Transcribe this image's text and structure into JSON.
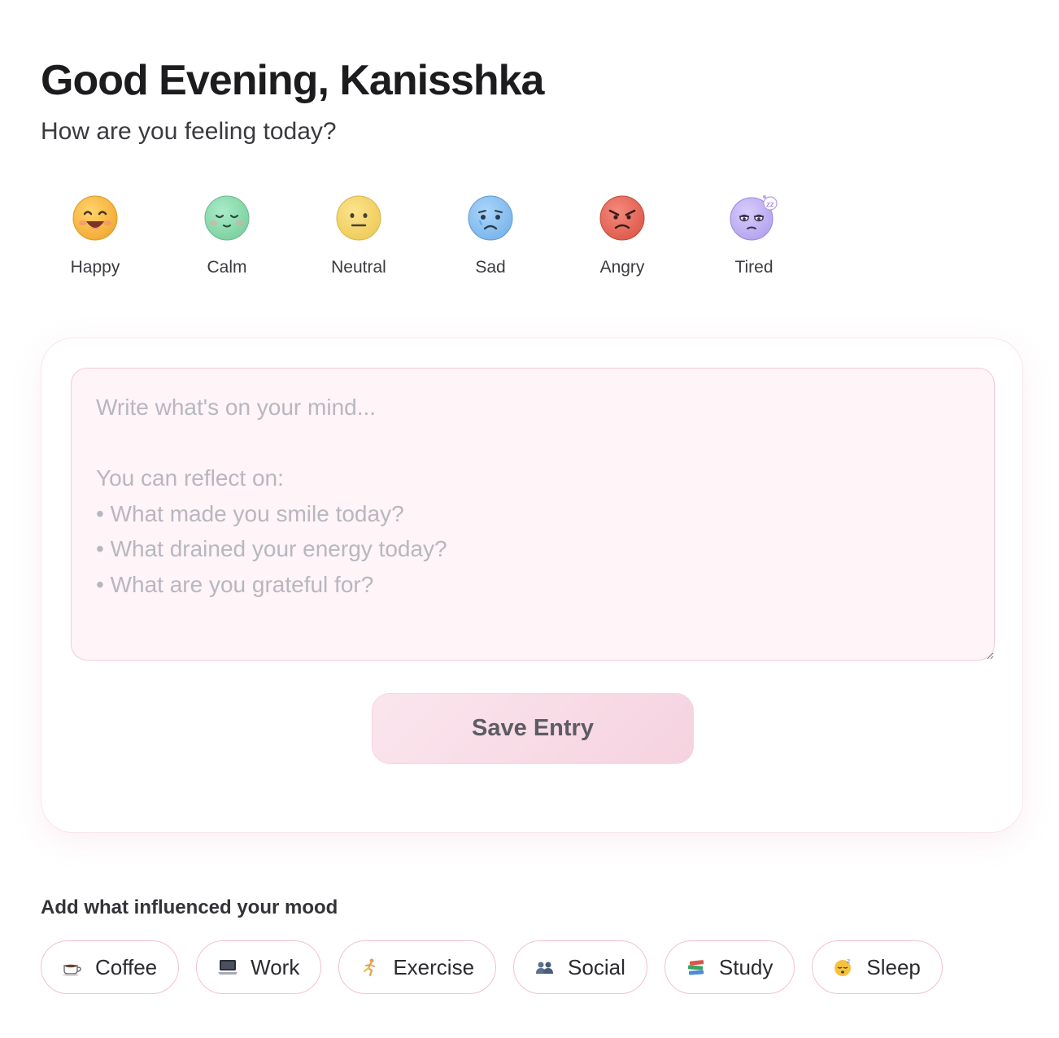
{
  "header": {
    "greeting": "Good Evening, Kanisshka",
    "question": "How are you feeling today?"
  },
  "moods": [
    {
      "label": "Happy",
      "icon": "happy-face-icon",
      "color": "#f5b53f"
    },
    {
      "label": "Calm",
      "icon": "calm-face-icon",
      "color": "#8fd9b0"
    },
    {
      "label": "Neutral",
      "icon": "neutral-face-icon",
      "color": "#f4d46a"
    },
    {
      "label": "Sad",
      "icon": "sad-face-icon",
      "color": "#8ec3f0"
    },
    {
      "label": "Angry",
      "icon": "angry-face-icon",
      "color": "#e86a5c"
    },
    {
      "label": "Tired",
      "icon": "tired-face-icon",
      "color": "#c5b6f2"
    }
  ],
  "journal": {
    "placeholder": "Write what's on your mind...\n\nYou can reflect on:\n• What made you smile today?\n• What drained your energy today?\n• What are you grateful for?",
    "value": "",
    "save_label": "Save Entry"
  },
  "influences": {
    "title": "Add what influenced your mood",
    "chips": [
      {
        "label": "Coffee",
        "icon": "coffee-icon"
      },
      {
        "label": "Work",
        "icon": "laptop-icon"
      },
      {
        "label": "Exercise",
        "icon": "running-icon"
      },
      {
        "label": "Social",
        "icon": "people-icon"
      },
      {
        "label": "Study",
        "icon": "books-icon"
      },
      {
        "label": "Sleep",
        "icon": "sleeping-face-icon"
      }
    ]
  },
  "colors": {
    "accent_pink": "#f5d2df",
    "border_pink": "#f2c1cf",
    "journal_bg": "#fff4f7"
  }
}
